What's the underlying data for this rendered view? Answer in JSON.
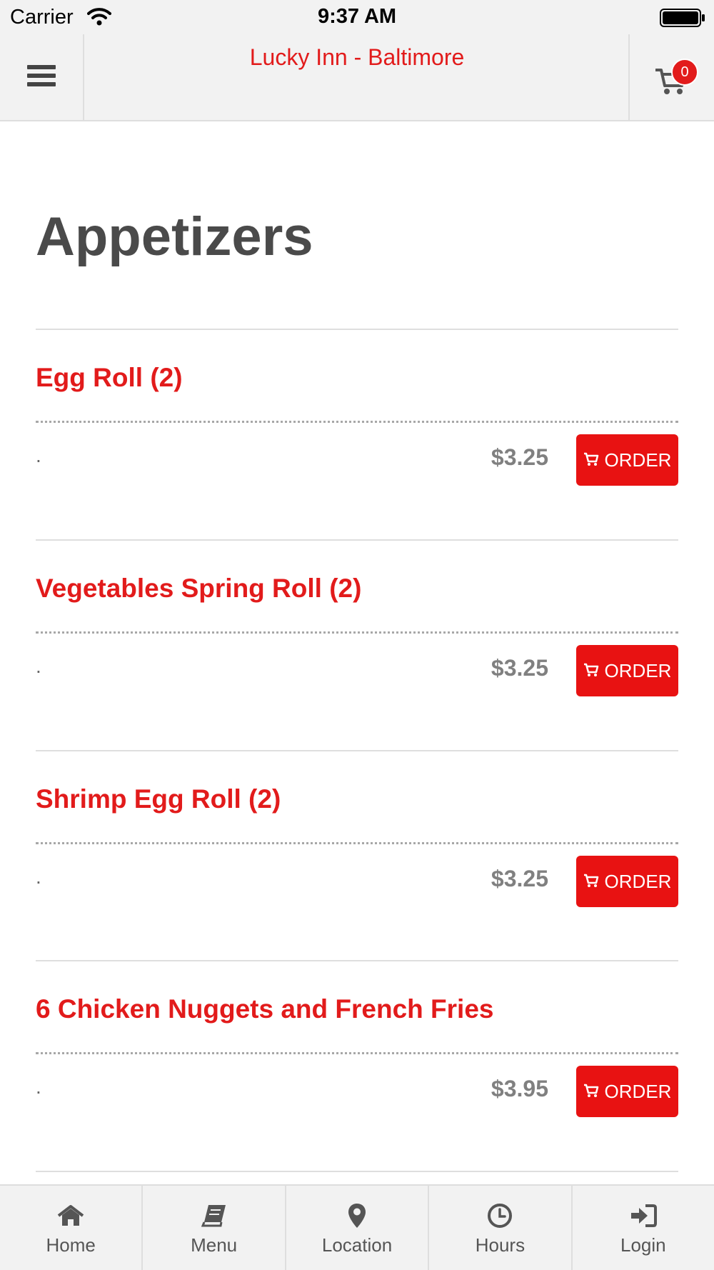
{
  "status": {
    "carrier": "Carrier",
    "time": "9:37 AM"
  },
  "header": {
    "title": "Lucky Inn - Baltimore",
    "cart_count": "0"
  },
  "section": {
    "title": "Appetizers"
  },
  "items": [
    {
      "name": "Egg Roll (2)",
      "description": ".",
      "price": "$3.25",
      "order_label": "ORDER"
    },
    {
      "name": "Vegetables Spring Roll (2)",
      "description": ".",
      "price": "$3.25",
      "order_label": "ORDER"
    },
    {
      "name": "Shrimp Egg Roll (2)",
      "description": ".",
      "price": "$3.25",
      "order_label": "ORDER"
    },
    {
      "name": "6 Chicken Nuggets and French Fries",
      "description": ".",
      "price": "$3.95",
      "order_label": "ORDER"
    }
  ],
  "tabs": [
    {
      "label": "Home",
      "icon": "home-icon"
    },
    {
      "label": "Menu",
      "icon": "book-icon"
    },
    {
      "label": "Location",
      "icon": "map-marker-icon"
    },
    {
      "label": "Hours",
      "icon": "clock-icon"
    },
    {
      "label": "Login",
      "icon": "sign-in-icon"
    }
  ],
  "colors": {
    "accent": "#e21b1b",
    "button": "#e81212",
    "title": "#4a4a4a",
    "price": "#808080",
    "bar_bg": "#f2f2f2"
  }
}
